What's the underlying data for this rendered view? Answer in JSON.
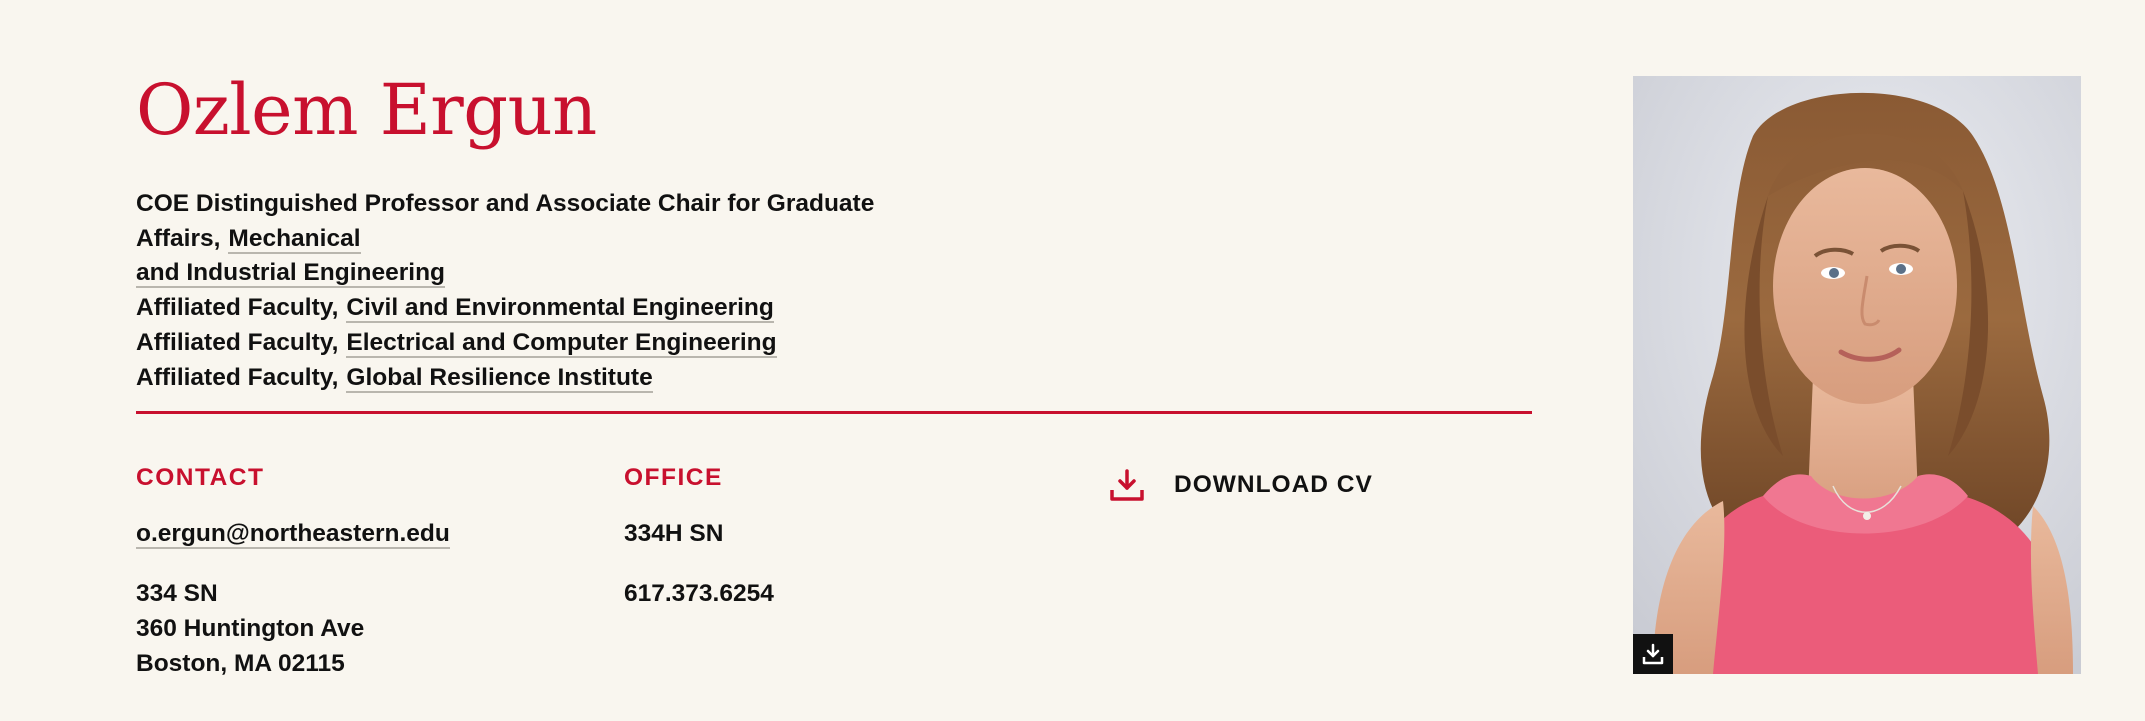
{
  "profile": {
    "name": "Ozlem Ergun"
  },
  "appointments": [
    {
      "role": "COE Distinguished Professor and Associate Chair for Graduate Affairs,",
      "dept": "Mechanical",
      "dept_cont": "and Industrial Engineering"
    },
    {
      "role": "Affiliated Faculty,",
      "dept": "Civil and Environmental Engineering"
    },
    {
      "role": "Affiliated Faculty,",
      "dept": "Electrical and Computer Engineering"
    },
    {
      "role": "Affiliated Faculty,",
      "dept": "Global Resilience Institute"
    }
  ],
  "contact": {
    "heading": "CONTACT",
    "email": "o.ergun@northeastern.edu",
    "address_line1": "334 SN",
    "address_line2": "360 Huntington Ave",
    "address_line3": "Boston, MA 02115"
  },
  "office": {
    "heading": "OFFICE",
    "room": "334H SN",
    "phone": "617.373.6254"
  },
  "download_cv": {
    "label": "DOWNLOAD CV",
    "icon": "download-icon"
  },
  "photo": {
    "icon": "download-icon"
  },
  "colors": {
    "accent": "#c8102e",
    "background": "#f9f6ef",
    "text": "#111111"
  }
}
